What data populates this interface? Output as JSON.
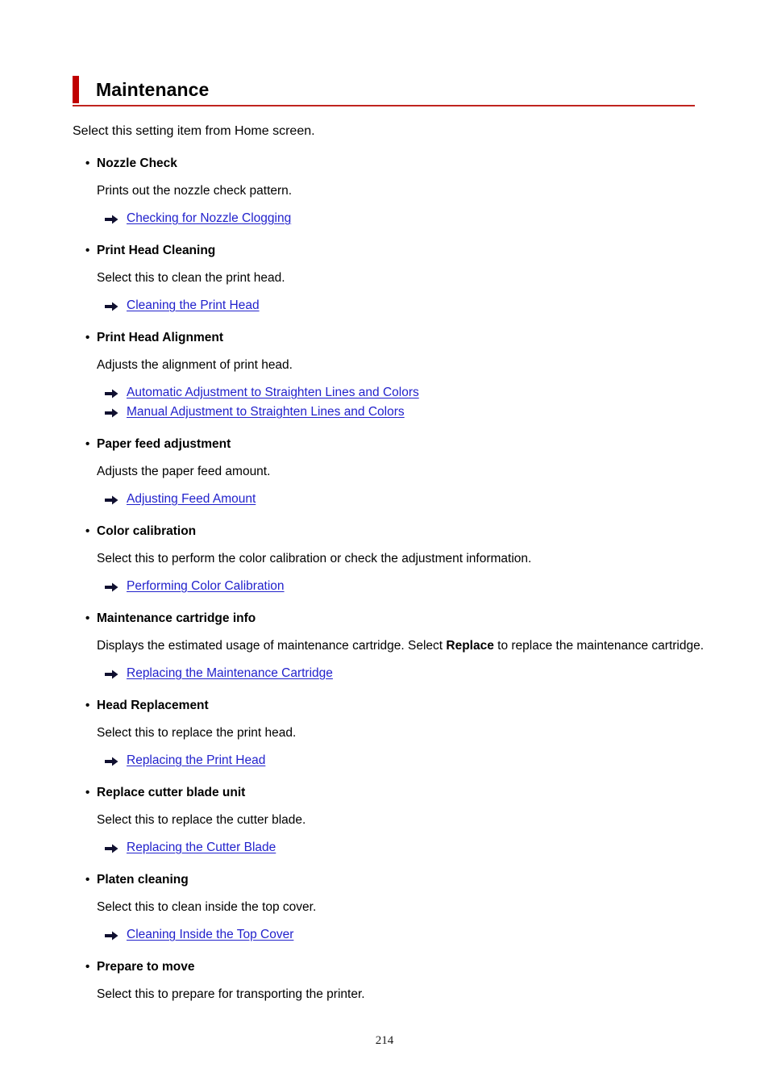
{
  "document": {
    "title": "Maintenance",
    "intro": "Select this setting item from Home screen.",
    "page_number": "214",
    "accent_color": "#c00000",
    "rule_color": "#c0241f",
    "link_color": "#2222cc",
    "bullet_glyph": "•",
    "arrow_icon_name": "right-arrow-icon"
  },
  "items": [
    {
      "title": "Nozzle Check",
      "description": "Prints out the nozzle check pattern.",
      "links": [
        {
          "label": "Checking for Nozzle Clogging"
        }
      ]
    },
    {
      "title": "Print Head Cleaning",
      "description": "Select this to clean the print head.",
      "links": [
        {
          "label": "Cleaning the Print Head"
        }
      ]
    },
    {
      "title": "Print Head Alignment",
      "description": "Adjusts the alignment of print head.",
      "links": [
        {
          "label": "Automatic Adjustment to Straighten Lines and Colors"
        },
        {
          "label": "Manual Adjustment to Straighten Lines and Colors"
        }
      ]
    },
    {
      "title": "Paper feed adjustment",
      "description": "Adjusts the paper feed amount.",
      "links": [
        {
          "label": "Adjusting Feed Amount"
        }
      ]
    },
    {
      "title": "Color calibration",
      "description": "Select this to perform the color calibration or check the adjustment information.",
      "links": [
        {
          "label": "Performing Color Calibration"
        }
      ]
    },
    {
      "title": "Maintenance cartridge info",
      "description_pre": "Displays the estimated usage of maintenance cartridge. Select ",
      "description_bold": "Replace",
      "description_post": " to replace the maintenance cartridge.",
      "links": [
        {
          "label": "Replacing the Maintenance Cartridge"
        }
      ]
    },
    {
      "title": "Head Replacement",
      "description": "Select this to replace the print head.",
      "links": [
        {
          "label": "Replacing the Print Head"
        }
      ]
    },
    {
      "title": "Replace cutter blade unit",
      "description": "Select this to replace the cutter blade.",
      "links": [
        {
          "label": "Replacing the Cutter Blade"
        }
      ]
    },
    {
      "title": "Platen cleaning",
      "description": "Select this to clean inside the top cover.",
      "links": [
        {
          "label": "Cleaning Inside the Top Cover"
        }
      ]
    },
    {
      "title": "Prepare to move",
      "description": "Select this to prepare for transporting the printer.",
      "links": []
    }
  ]
}
